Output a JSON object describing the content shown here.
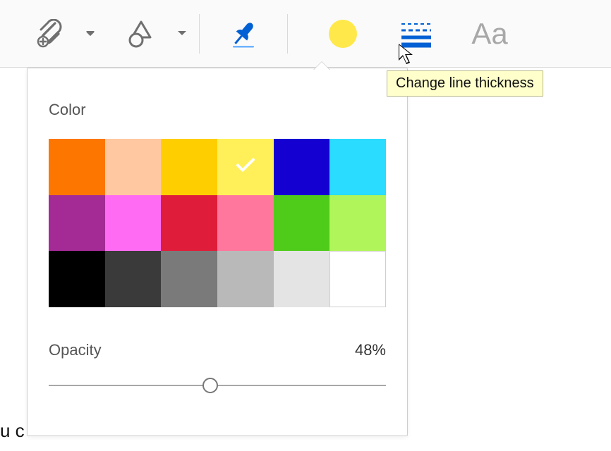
{
  "toolbar": {
    "attach_tool": "attach",
    "shape_tool": "shapes",
    "pin_tool": "pin",
    "color_tool": "color",
    "line_thickness_tool": "line-thickness",
    "text_tool": "text",
    "selected_color": "#ffe84a",
    "pin_color": "#0060d4",
    "line_color": "#0060d4",
    "icon_gray": "#707070",
    "text_gray": "#a8a8a8"
  },
  "tooltip": {
    "line_thickness": "Change line thickness"
  },
  "panel": {
    "color_label": "Color",
    "swatches": [
      {
        "hex": "#fd7600",
        "selected": false
      },
      {
        "hex": "#ffc8a0",
        "selected": false
      },
      {
        "hex": "#ffce00",
        "selected": false
      },
      {
        "hex": "#fff05a",
        "selected": true
      },
      {
        "hex": "#1400d1",
        "selected": false
      },
      {
        "hex": "#2adcff",
        "selected": false
      },
      {
        "hex": "#a42a96",
        "selected": false
      },
      {
        "hex": "#ff6bf3",
        "selected": false
      },
      {
        "hex": "#df1d3a",
        "selected": false
      },
      {
        "hex": "#ff779d",
        "selected": false
      },
      {
        "hex": "#4fcb1a",
        "selected": false
      },
      {
        "hex": "#b0f55a",
        "selected": false
      },
      {
        "hex": "#000000",
        "selected": false
      },
      {
        "hex": "#3a3a3a",
        "selected": false
      },
      {
        "hex": "#7a7a7a",
        "selected": false
      },
      {
        "hex": "#b9b9b9",
        "selected": false
      },
      {
        "hex": "#e4e4e4",
        "selected": false
      },
      {
        "hex": "#ffffff",
        "selected": false,
        "bordered": true
      }
    ],
    "opacity_label": "Opacity",
    "opacity_value_display": "48%",
    "opacity_value": 48
  },
  "document": {
    "visible_fragment": "u c"
  }
}
